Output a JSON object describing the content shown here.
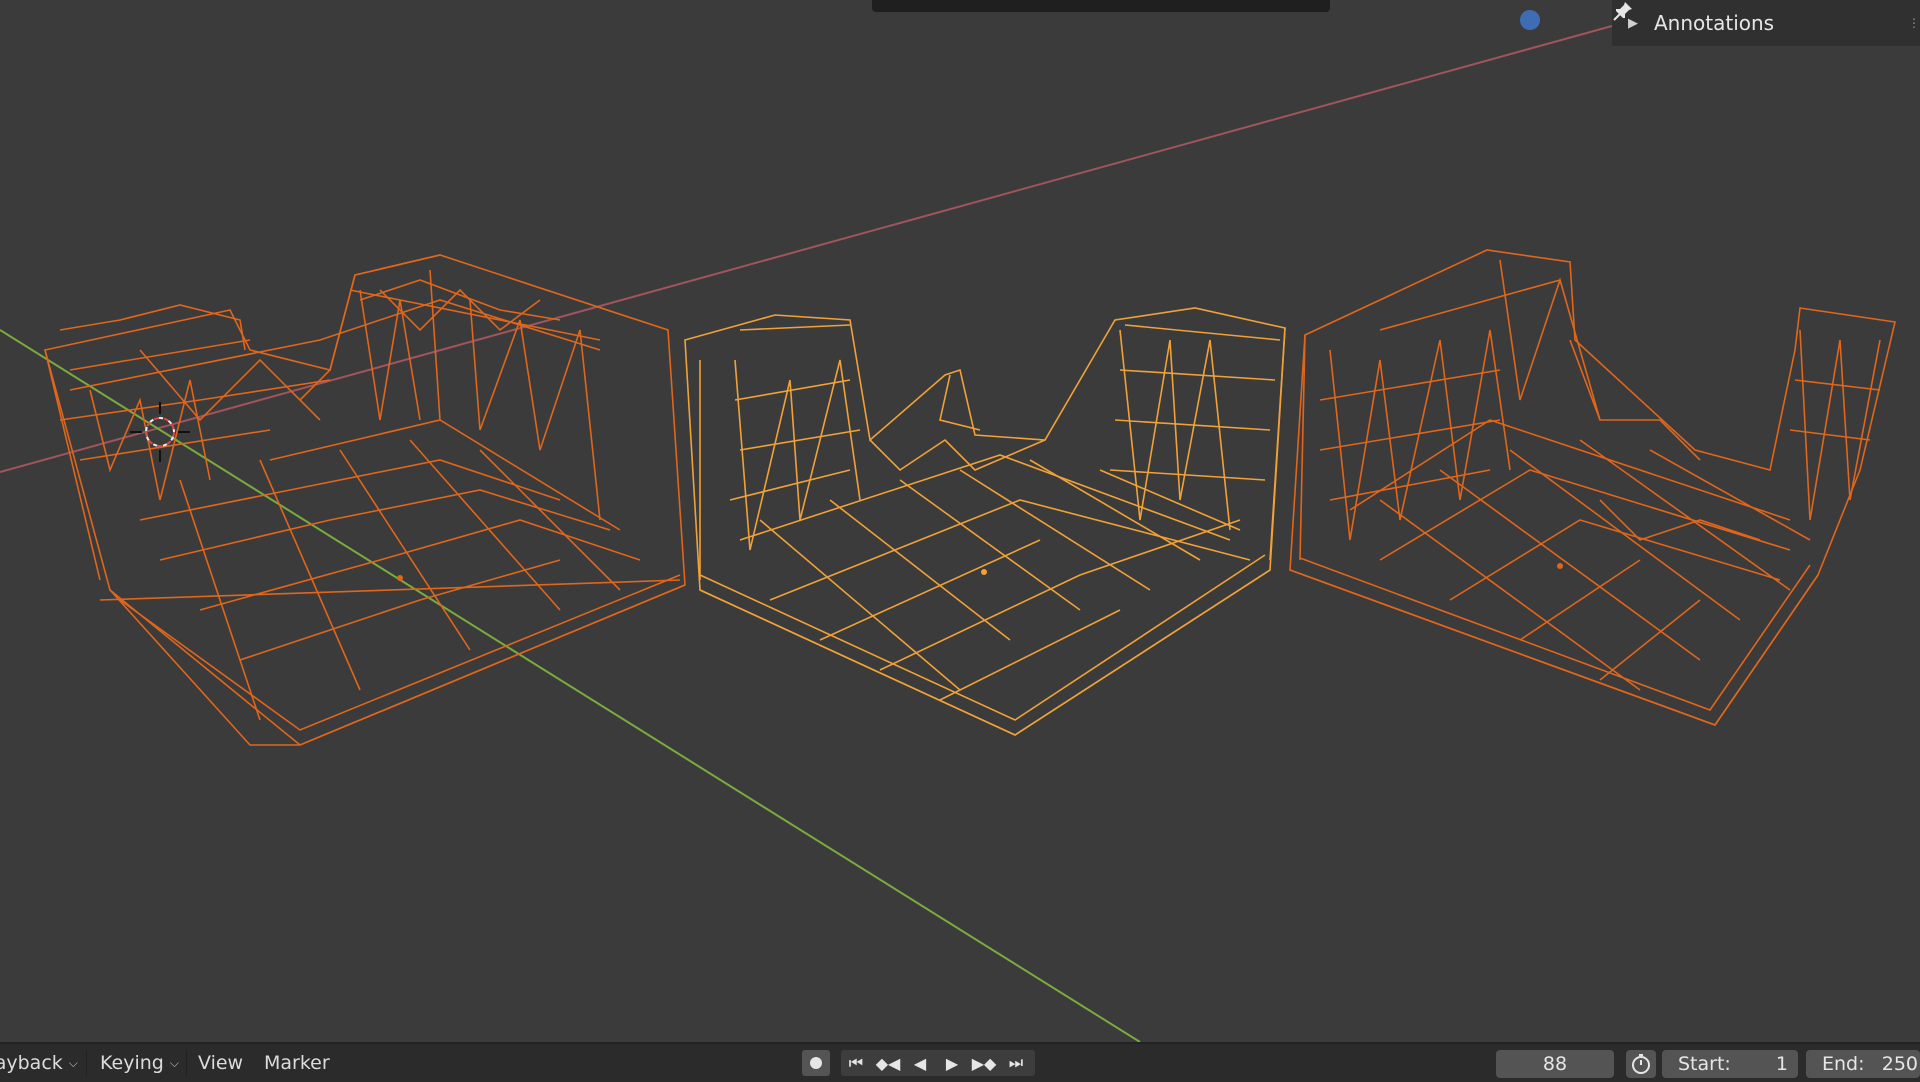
{
  "viewport": {
    "annotations_panel": {
      "label": "Annotations",
      "expand_icon": "triangle-right-icon",
      "pin_icon": "pin-icon"
    },
    "colors": {
      "background": "#3b3b3b",
      "selected_wire": "#e0661c",
      "active_wire": "#f0a238",
      "x_axis": "#a0545c",
      "y_axis": "#7aab3e",
      "nav_gizmo": "#3f6db3"
    }
  },
  "timeline": {
    "menus": [
      {
        "label": "Playback",
        "has_dropdown": true
      },
      {
        "label": "Keying",
        "has_dropdown": true
      },
      {
        "label": "View",
        "has_dropdown": false
      },
      {
        "label": "Marker",
        "has_dropdown": false
      }
    ],
    "controls": [
      "record-icon",
      "jump-start-icon",
      "prev-keyframe-icon",
      "play-reverse-icon",
      "play-icon",
      "next-keyframe-icon",
      "jump-end-icon"
    ],
    "current_frame": "88",
    "start_label": "Start:",
    "start_value": "1",
    "end_label": "End:",
    "end_value": "250"
  }
}
